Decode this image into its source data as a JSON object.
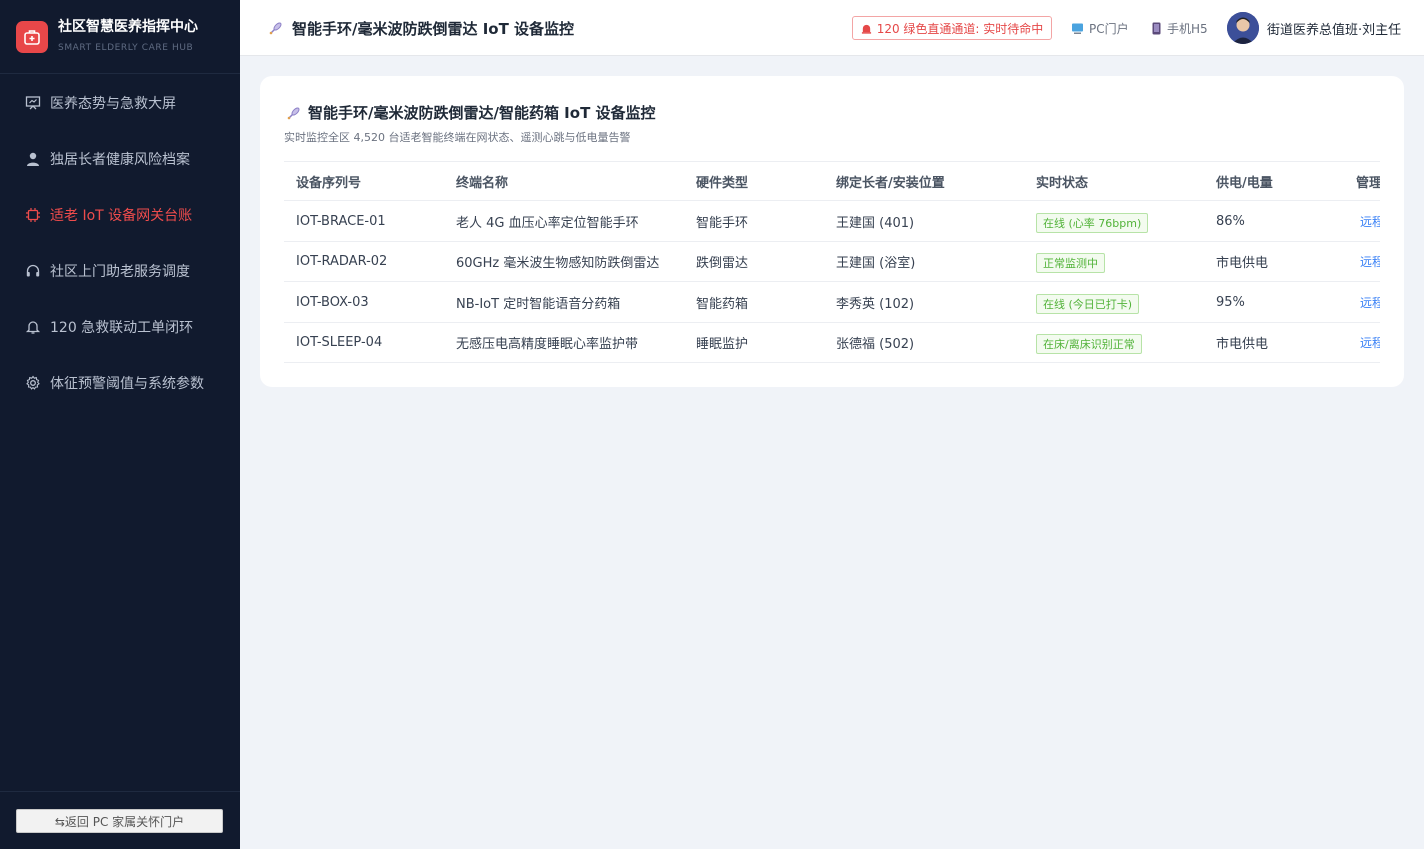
{
  "brand": {
    "title": "社区智慧医养指挥中心",
    "subtitle": "SMART ELDERLY CARE HUB",
    "color": "#e84749"
  },
  "sidebar": {
    "items": [
      {
        "label": "医养态势与急救大屏",
        "icon": "dashboard-icon",
        "active": false
      },
      {
        "label": "独居长者健康风险档案",
        "icon": "user-icon",
        "active": false
      },
      {
        "label": "适老 IoT 设备网关台账",
        "icon": "chip-icon",
        "active": true
      },
      {
        "label": "社区上门助老服务调度",
        "icon": "headset-icon",
        "active": false
      },
      {
        "label": "120 急救联动工单闭环",
        "icon": "bell-icon",
        "active": false
      },
      {
        "label": "体征预警阈值与系统参数",
        "icon": "gear-icon",
        "active": false
      }
    ],
    "back_button": "⇆返回 PC 家属关怀门户"
  },
  "header": {
    "title": "智能手环/毫米波防跌倒雷达 IoT 设备监控",
    "title_icon": "satellite-icon",
    "alert": "120 绿色直通通道: 实时待命中",
    "alert_icon": "siren-icon",
    "pc_link": "PC门户",
    "mobile_link": "手机H5",
    "user": "街道医养总值班·刘主任"
  },
  "card": {
    "title": "智能手环/毫米波防跌倒雷达/智能药箱 IoT 设备监控",
    "subtitle": "实时监控全区 4,520 台适老智能终端在网状态、遥测心跳与低电量告警"
  },
  "table": {
    "columns": [
      "设备序列号",
      "终端名称",
      "硬件类型",
      "绑定长者/安装位置",
      "实时状态",
      "供电/电量",
      "管理"
    ],
    "rows": [
      {
        "serial": "IOT-BRACE-01",
        "name": "老人 4G 血压心率定位智能手环",
        "type": "智能手环",
        "bind": "王建国 (401)",
        "status": "在线 (心率 76bpm)",
        "power": "86%",
        "action": "远程"
      },
      {
        "serial": "IOT-RADAR-02",
        "name": "60GHz 毫米波生物感知防跌倒雷达",
        "type": "跌倒雷达",
        "bind": "王建国 (浴室)",
        "status": "正常监测中",
        "power": "市电供电",
        "action": "远程"
      },
      {
        "serial": "IOT-BOX-03",
        "name": "NB-IoT 定时智能语音分药箱",
        "type": "智能药箱",
        "bind": "李秀英 (102)",
        "status": "在线 (今日已打卡)",
        "power": "95%",
        "action": "远程"
      },
      {
        "serial": "IOT-SLEEP-04",
        "name": "无感压电高精度睡眠心率监护带",
        "type": "睡眠监护",
        "bind": "张德福 (502)",
        "status": "在床/离床识别正常",
        "power": "市电供电",
        "action": "远程"
      }
    ]
  },
  "colors": {
    "sidebar_bg": "#111a2e",
    "accent_red": "#ef4c4c",
    "status_green": "#52b339",
    "link_blue": "#3b82f6"
  }
}
